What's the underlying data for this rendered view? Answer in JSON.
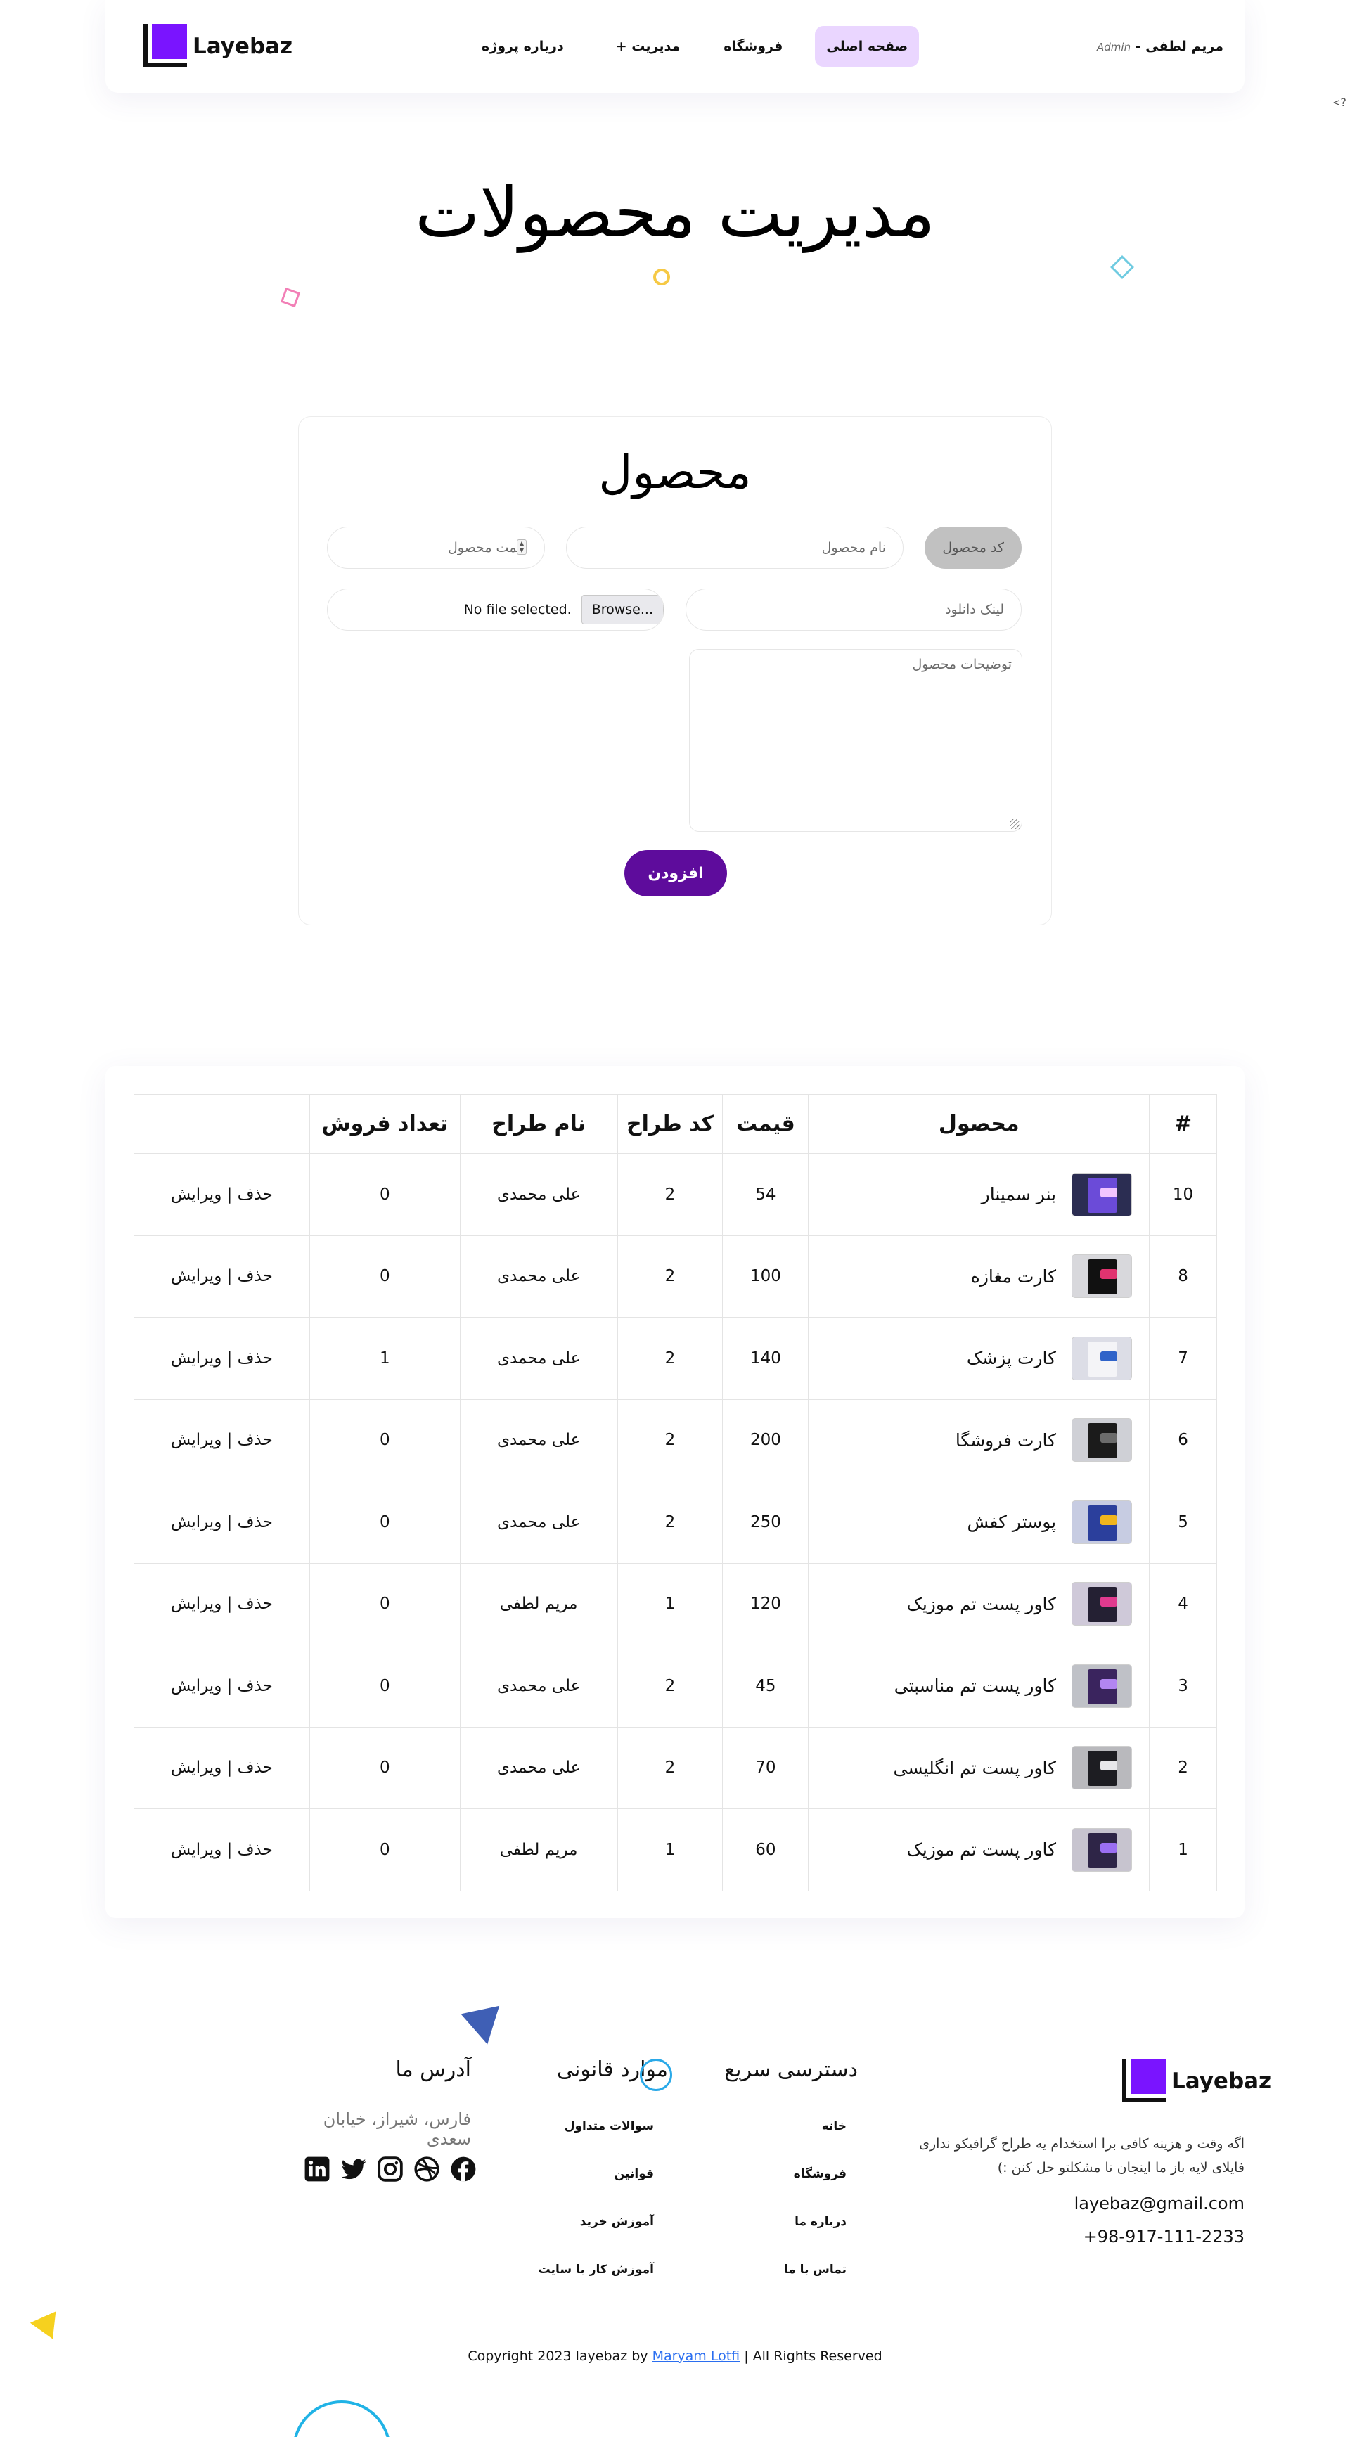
{
  "header": {
    "logo_text": "Layebaz",
    "nav": {
      "home": "صفحه اصلی",
      "shop": "فروشگاه",
      "manage": "مدیریت",
      "manage_plus": "+",
      "about": "درباره پروژه"
    },
    "user_name": "مریم لطفی -",
    "user_role": "Admin"
  },
  "corner_code": "<?",
  "page_title": "مدیریت محصولات",
  "form": {
    "title": "محصول",
    "code_placeholder": "کد محصول",
    "name_placeholder": "نام محصول",
    "price_placeholder": "قیمت محصول",
    "download_placeholder": "لینک دانلود",
    "file_button": "Browse...",
    "file_status": "No file selected.",
    "description_placeholder": "توضیحات محصول",
    "submit_label": "افزودن"
  },
  "table": {
    "headers": [
      "#",
      "محصول",
      "قیمت",
      "کد طراح",
      "نام طراح",
      "تعداد فروش",
      ""
    ],
    "rows": [
      {
        "id": "10",
        "name": "بنر سمینار",
        "price": "54",
        "designer_code": "2",
        "designer_name": "علی محمدی",
        "sales": "0",
        "actions": "حذف | ویرایش",
        "thumb": "seminar-banner"
      },
      {
        "id": "8",
        "name": "کارت مغازه",
        "price": "100",
        "designer_code": "2",
        "designer_name": "علی محمدی",
        "sales": "0",
        "actions": "حذف | ویرایش",
        "thumb": "shop-card"
      },
      {
        "id": "7",
        "name": "کارت پزشک",
        "price": "140",
        "designer_code": "2",
        "designer_name": "علی محمدی",
        "sales": "1",
        "actions": "حذف | ویرایش",
        "thumb": "doctor-card"
      },
      {
        "id": "6",
        "name": "کارت فروشگا",
        "price": "200",
        "designer_code": "2",
        "designer_name": "علی محمدی",
        "sales": "0",
        "actions": "حذف | ویرایش",
        "thumb": "store-card"
      },
      {
        "id": "5",
        "name": "پوستر کفش",
        "price": "250",
        "designer_code": "2",
        "designer_name": "علی محمدی",
        "sales": "0",
        "actions": "حذف | ویرایش",
        "thumb": "shoe-poster"
      },
      {
        "id": "4",
        "name": "کاور پست تم موزیک",
        "price": "120",
        "designer_code": "1",
        "designer_name": "مریم لطفی",
        "sales": "0",
        "actions": "حذف | ویرایش",
        "thumb": "music-cover"
      },
      {
        "id": "3",
        "name": "کاور پست تم مناسبتی",
        "price": "45",
        "designer_code": "2",
        "designer_name": "علی محمدی",
        "sales": "0",
        "actions": "حذف | ویرایش",
        "thumb": "occasion-cover"
      },
      {
        "id": "2",
        "name": "کاور پست تم انگلیسی",
        "price": "70",
        "designer_code": "2",
        "designer_name": "علی محمدی",
        "sales": "0",
        "actions": "حذف | ویرایش",
        "thumb": "english-cover"
      },
      {
        "id": "1",
        "name": "کاور پست تم موزیک",
        "price": "60",
        "designer_code": "1",
        "designer_name": "مریم لطفی",
        "sales": "0",
        "actions": "حذف | ویرایش",
        "thumb": "music-cover-2"
      }
    ]
  },
  "footer": {
    "logo_text": "Layebaz",
    "about": "اگه وقت و هزینه کافی برا استخدام یه طراح گرافیکو نداری فایلای لایه باز ما اینجان تا مشکلتو حل کنن :)",
    "email": "layebaz@gmail.com",
    "phone": "+98-917-111-2233",
    "quick_access": {
      "title": "دسترسی سریع",
      "links": [
        "خانه",
        "فروشگاه",
        "درباره ما",
        "تماس با ما"
      ]
    },
    "legal": {
      "title": "موارد قانونی",
      "links": [
        "سوالات متداول",
        "قوانین",
        "آموزش خرید",
        "آموزش کار با سایت"
      ]
    },
    "address": {
      "title": "آدرس ما",
      "text": "فارس، شیراز، خیابان سعدی",
      "socials": [
        "facebook-icon",
        "dribbble-icon",
        "instagram-icon",
        "twitter-icon",
        "linkedin-icon"
      ]
    },
    "copyright_prefix": "Copyright 2023 layebaz by",
    "copyright_author": "Maryam Lotfi",
    "copyright_suffix": "| All Rights Reserved"
  },
  "colors": {
    "brand_purple": "#7a14ff",
    "button_purple": "#5e0c9c",
    "nav_active_bg": "#ead6ff",
    "link_blue": "#2a6ef0"
  }
}
